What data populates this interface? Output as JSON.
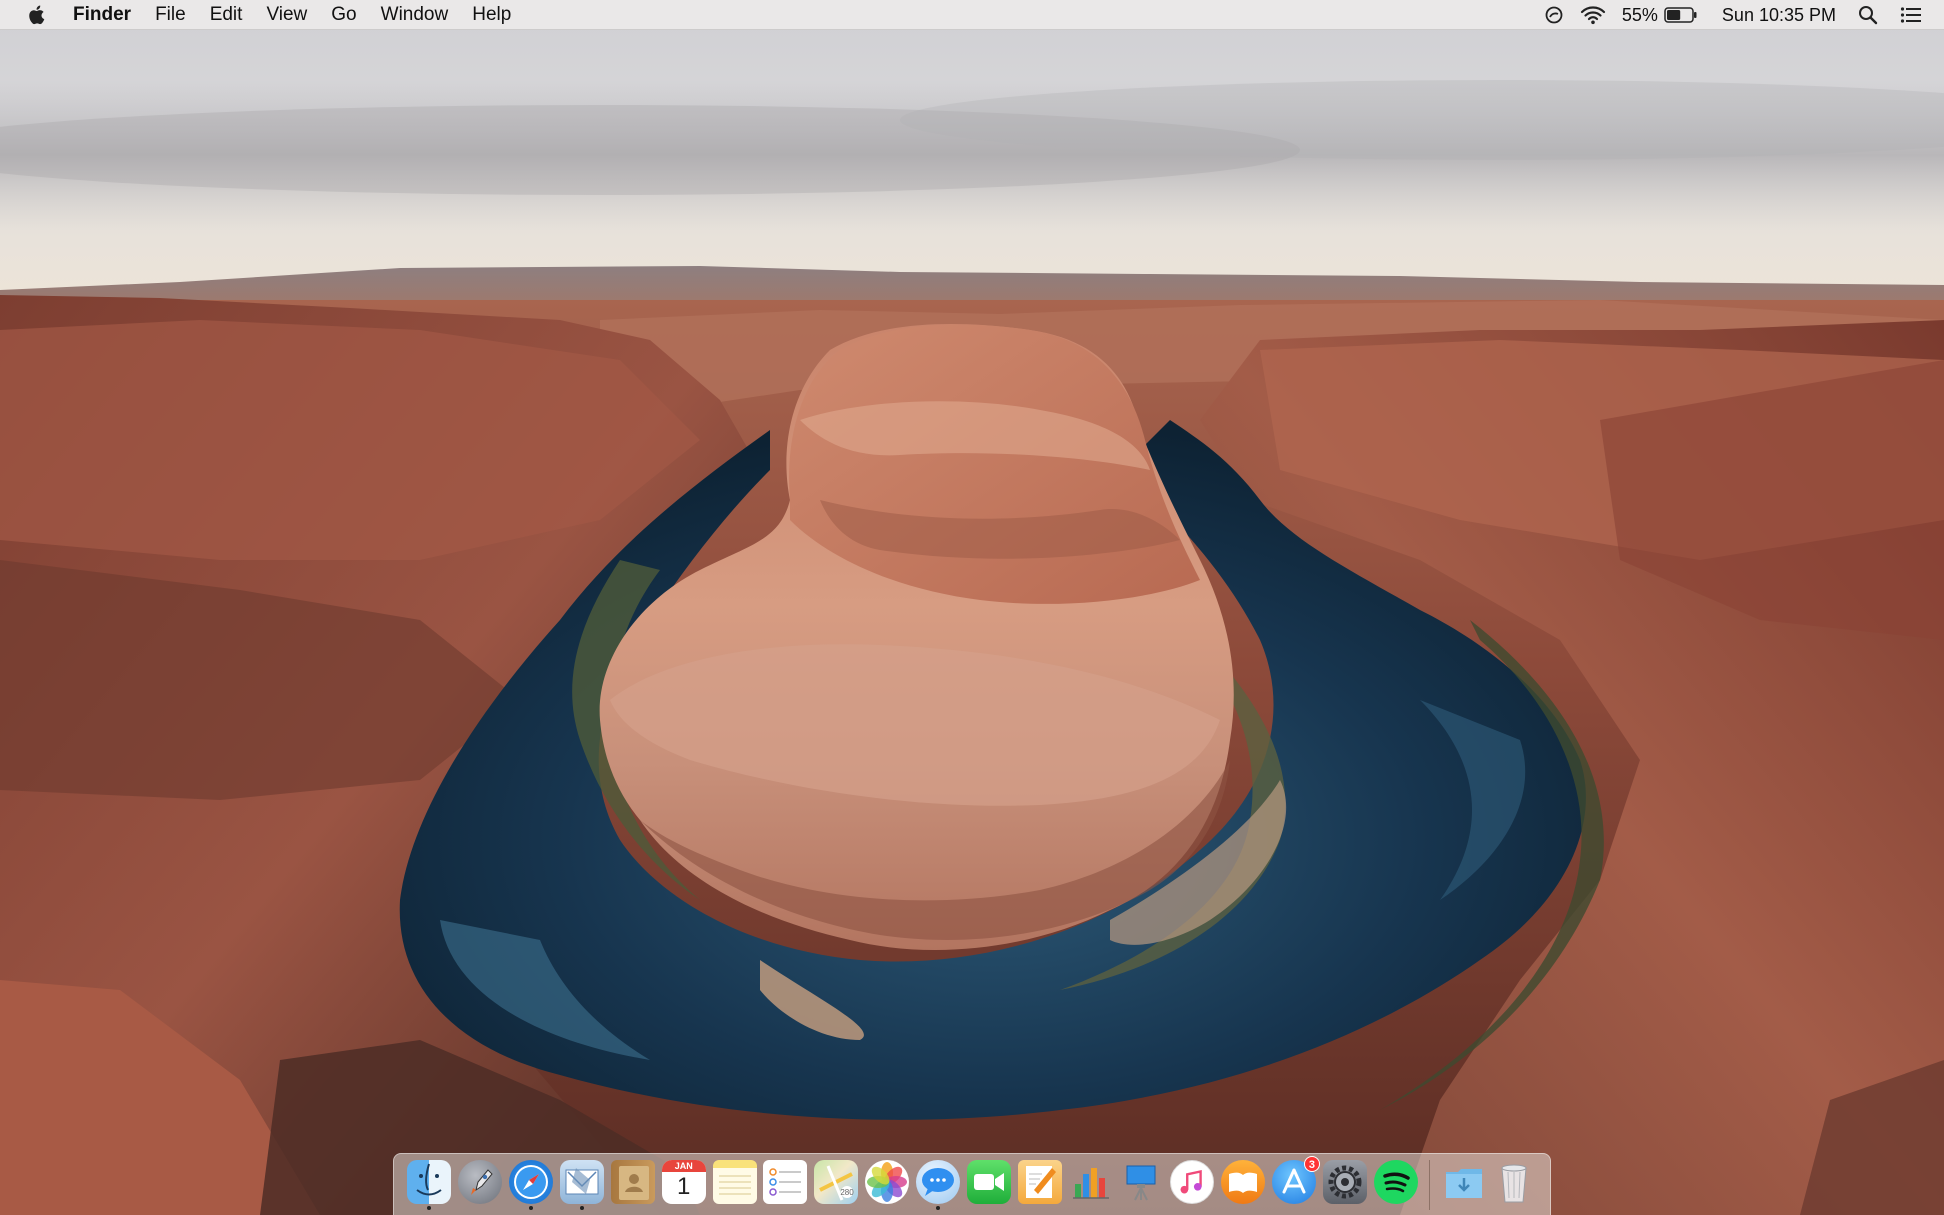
{
  "menubar": {
    "apple_icon": "apple-icon",
    "app_name": "Finder",
    "menus": [
      "File",
      "Edit",
      "View",
      "Go",
      "Window",
      "Help"
    ],
    "status": {
      "battery_percent": "55%",
      "battery_level": 0.55,
      "clock": "Sun 10:35 PM"
    }
  },
  "dock": {
    "apps": [
      {
        "name": "Finder",
        "icon": "finder-icon",
        "running": true
      },
      {
        "name": "Launchpad",
        "icon": "launchpad-icon",
        "running": false
      },
      {
        "name": "Safari",
        "icon": "safari-icon",
        "running": true
      },
      {
        "name": "Mail",
        "icon": "mail-icon",
        "running": true
      },
      {
        "name": "Contacts",
        "icon": "contacts-icon",
        "running": false
      },
      {
        "name": "Calendar",
        "icon": "calendar-icon",
        "running": false,
        "month": "JAN",
        "day": "1"
      },
      {
        "name": "Notes",
        "icon": "notes-icon",
        "running": false
      },
      {
        "name": "Reminders",
        "icon": "reminders-icon",
        "running": false
      },
      {
        "name": "Maps",
        "icon": "maps-icon",
        "running": false
      },
      {
        "name": "Photos",
        "icon": "photos-icon",
        "running": false
      },
      {
        "name": "Messages",
        "icon": "messages-icon",
        "running": true
      },
      {
        "name": "FaceTime",
        "icon": "facetime-icon",
        "running": false
      },
      {
        "name": "Pages",
        "icon": "pages-icon",
        "running": false
      },
      {
        "name": "Numbers",
        "icon": "numbers-icon",
        "running": false
      },
      {
        "name": "Keynote",
        "icon": "keynote-icon",
        "running": false
      },
      {
        "name": "iTunes",
        "icon": "itunes-icon",
        "running": false
      },
      {
        "name": "iBooks",
        "icon": "ibooks-icon",
        "running": false
      },
      {
        "name": "App Store",
        "icon": "app-store-icon",
        "running": false,
        "badge": "3"
      },
      {
        "name": "System Preferences",
        "icon": "system-preferences-icon",
        "running": false
      },
      {
        "name": "Spotify",
        "icon": "spotify-icon",
        "running": false
      }
    ],
    "downloads_icon": "downloads-folder-icon",
    "trash_icon": "trash-icon"
  },
  "colors": {
    "sky": "#dcdcde",
    "rock": "#a85a44",
    "river": "#16324a",
    "menubar": "#eceae9"
  }
}
